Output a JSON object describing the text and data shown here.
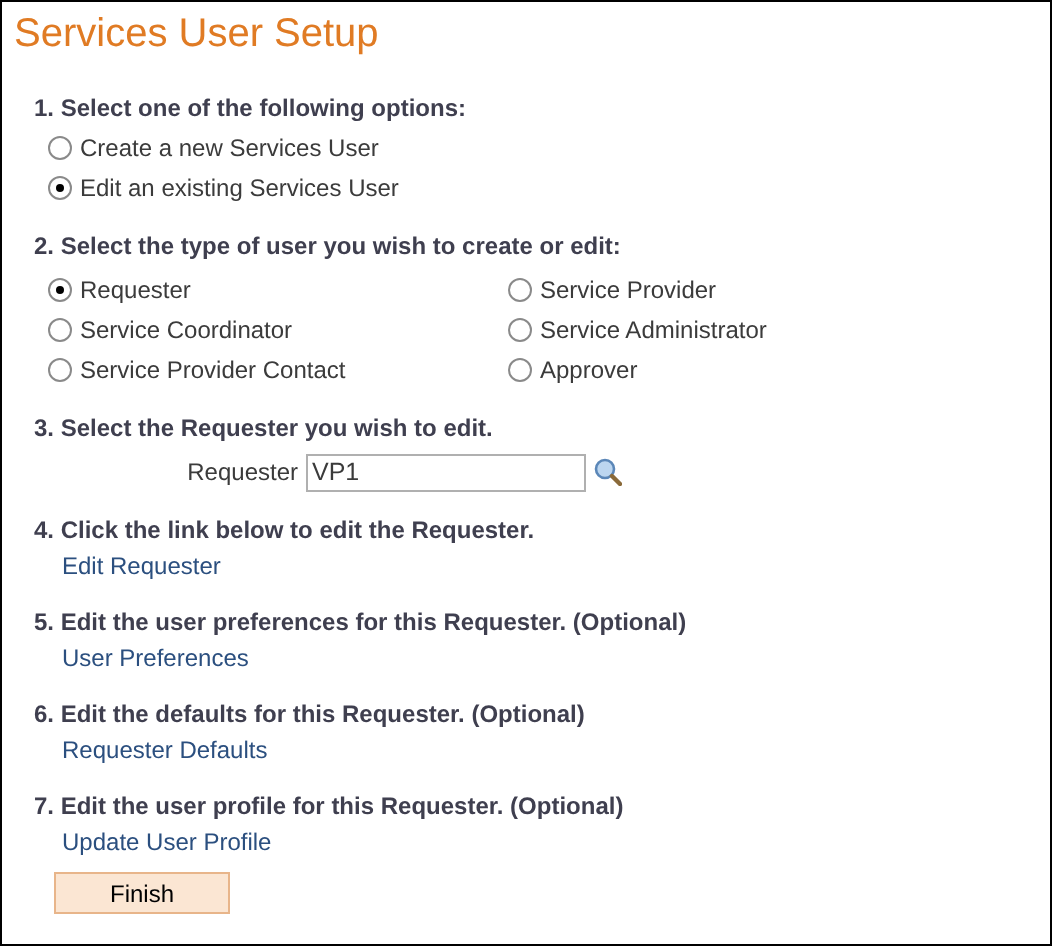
{
  "title": "Services User Setup",
  "sections": [
    {
      "kind": "radio_list",
      "heading": "1. Select one of the following options:",
      "options": [
        {
          "label": "Create a new Services User",
          "selected": false
        },
        {
          "label": "Edit an existing Services User",
          "selected": true
        }
      ]
    },
    {
      "kind": "radio_grid",
      "heading": "2. Select the type of user you wish to create or edit:",
      "options": [
        {
          "label": "Requester",
          "selected": true
        },
        {
          "label": "Service Provider",
          "selected": false
        },
        {
          "label": "Service Coordinator",
          "selected": false
        },
        {
          "label": "Service Administrator",
          "selected": false
        },
        {
          "label": "Service Provider Contact",
          "selected": false
        },
        {
          "label": "Approver",
          "selected": false
        }
      ]
    },
    {
      "kind": "field",
      "heading": "3. Select the Requester you wish to edit.",
      "label": "Requester",
      "value": "VP1"
    },
    {
      "kind": "link",
      "heading": "4. Click the link below to edit the Requester.",
      "link": "Edit Requester"
    },
    {
      "kind": "link",
      "heading": "5. Edit the user preferences for this Requester. (Optional)",
      "link": "User Preferences"
    },
    {
      "kind": "link",
      "heading": "6. Edit the defaults for this Requester. (Optional)",
      "link": "Requester Defaults"
    },
    {
      "kind": "link",
      "heading": "7. Edit the user profile for this Requester. (Optional)",
      "link": "Update User Profile"
    }
  ],
  "finish_button": "Finish"
}
